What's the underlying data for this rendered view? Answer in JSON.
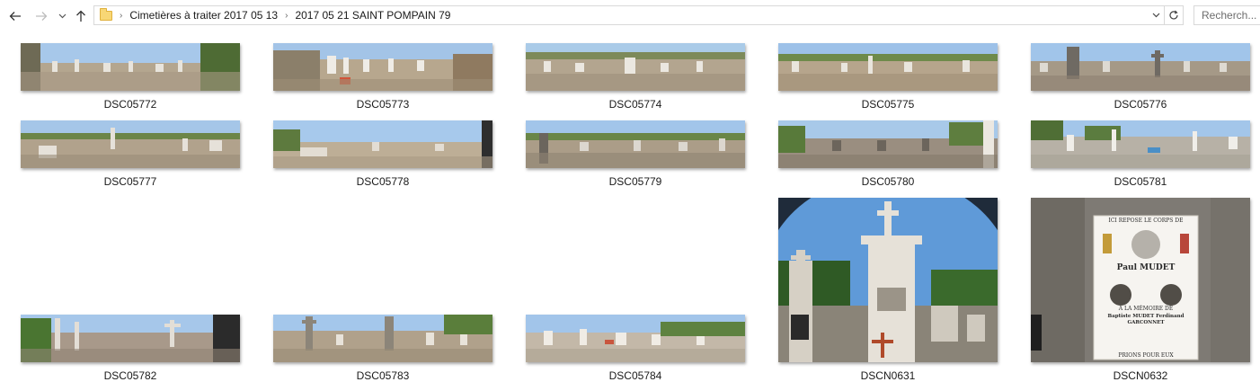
{
  "toolbar": {
    "back_icon": "arrow-left-icon",
    "forward_icon": "arrow-right-icon",
    "recent_icon": "chevron-down-icon",
    "up_icon": "arrow-up-icon",
    "breadcrumbs": [
      "Cimetières à traiter 2017 05 13",
      "2017 05 21 SAINT POMPAIN 79"
    ],
    "search_placeholder": "Recherch..."
  },
  "files": [
    {
      "name": "DSC05772",
      "kind": "pano"
    },
    {
      "name": "DSC05773",
      "kind": "pano"
    },
    {
      "name": "DSC05774",
      "kind": "pano"
    },
    {
      "name": "DSC05775",
      "kind": "pano"
    },
    {
      "name": "DSC05776",
      "kind": "pano"
    },
    {
      "name": "DSC05777",
      "kind": "pano"
    },
    {
      "name": "DSC05778",
      "kind": "pano"
    },
    {
      "name": "DSC05779",
      "kind": "pano"
    },
    {
      "name": "DSC05780",
      "kind": "pano"
    },
    {
      "name": "DSC05781",
      "kind": "pano"
    },
    {
      "name": "DSC05782",
      "kind": "pano"
    },
    {
      "name": "DSC05783",
      "kind": "pano"
    },
    {
      "name": "DSC05784",
      "kind": "pano"
    },
    {
      "name": "DSCN0631",
      "kind": "tall"
    },
    {
      "name": "DSCN0632",
      "kind": "tall"
    }
  ],
  "plaque": {
    "line1": "ICI REPOSE LE CORPS DE",
    "line2": "Paul  MUDET",
    "line3": "A LA MÉMOIRE DE",
    "line4": "Baptiste MUDET  Ferdinand GARCONNET",
    "line5": "PRIONS POUR EUX"
  },
  "colors": {
    "sky": "#9fc3e6",
    "ground": "#b9a993",
    "stone": "#e4e0d8"
  }
}
